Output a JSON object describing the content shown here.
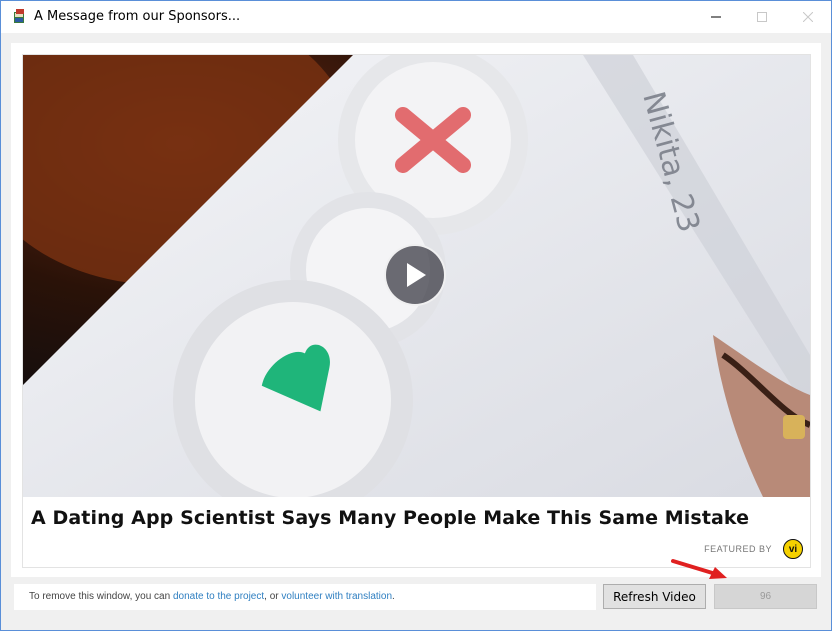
{
  "window": {
    "title": "A Message from our Sponsors...",
    "controls": [
      "minimize-icon",
      "maximize-icon",
      "close-icon"
    ]
  },
  "ad": {
    "headline": "A Dating App Scientist Says Many People Make This Same Mistake",
    "featured_by": "FEATURED BY",
    "vi_logo": "vi",
    "video_overlay_text": "Nikita, 23"
  },
  "footer": {
    "notice_prefix": "To remove this window, you can ",
    "donate_link": "donate to the project",
    "notice_middle": ", or ",
    "volunteer_link": "volunteer with translation",
    "notice_suffix": ".",
    "refresh_label": "Refresh Video",
    "countdown": "96"
  },
  "colors": {
    "link": "#2f7fc1",
    "arrow": "#e02020",
    "window_border": "#5a8fd8",
    "vi_yellow": "#f5d100"
  }
}
